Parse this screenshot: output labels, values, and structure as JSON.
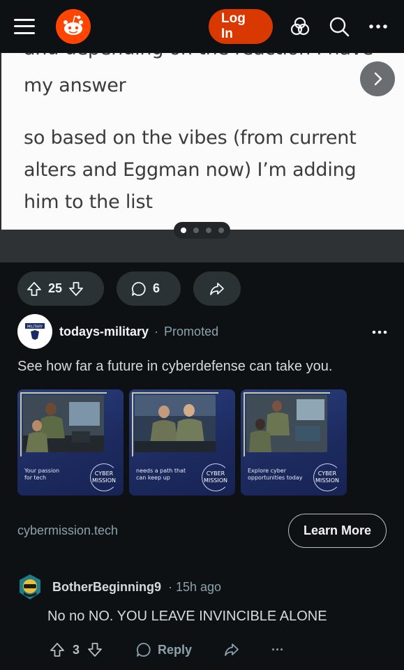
{
  "header": {
    "login_label": "Log In",
    "icons": [
      "menu-icon",
      "reddit-logo",
      "advertise-icon",
      "search-icon",
      "more-icon"
    ]
  },
  "carousel": {
    "lines": [
      "and depending on the reaction I have",
      "my answer",
      "so based on the vibes (from current",
      "alters and Eggman now) I’m adding",
      "him to the list"
    ],
    "slide_count": 4,
    "active_slide": 1
  },
  "post_actions": {
    "votes": "25",
    "comments": "6"
  },
  "promoted": {
    "author": "todays-military",
    "separator": "·",
    "tag": "Promoted",
    "avatar_text": "TODAY'S MILITARY",
    "title": "See how far a future in cyberdefense can take you.",
    "tiles": [
      {
        "caption_1": "Your passion",
        "caption_2": "for tech",
        "badge_1": "CYBER",
        "badge_2": "MISSION"
      },
      {
        "caption_1": "needs a path that",
        "caption_2": "can keep up",
        "badge_1": "CYBER",
        "badge_2": "MISSION"
      },
      {
        "caption_1": "Explore cyber",
        "caption_2": "opportunities today",
        "badge_1": "CYBER",
        "badge_2": "MISSION"
      }
    ],
    "domain": "cybermission.tech",
    "cta": "Learn More"
  },
  "comment": {
    "user": "BotherBeginning9",
    "time": "· 15h ago",
    "body": "No no NO. YOU LEAVE INVINCIBLE ALONE",
    "votes": "3",
    "reply_label": "Reply",
    "more": "···"
  },
  "colors": {
    "background": "#0e1113",
    "brand": "#ff4500",
    "login_button": "#d93900",
    "pill": "#2a3236",
    "muted": "#8ba2ad"
  }
}
